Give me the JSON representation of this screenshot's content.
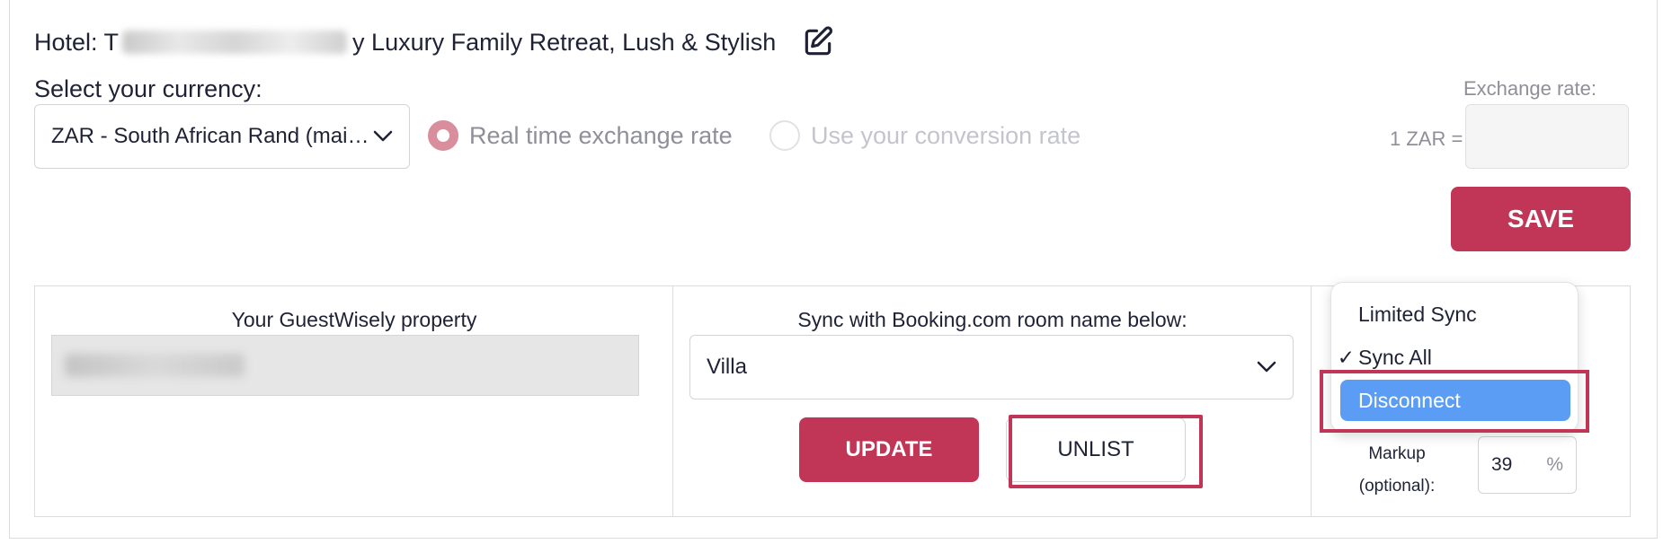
{
  "hotel": {
    "prefix": "Hotel: T",
    "name_visible": "y Luxury Family Retreat, Lush & Stylish"
  },
  "currency": {
    "label": "Select your currency:",
    "selected": "ZAR - South African Rand (mai…",
    "options": {
      "realtime_label": "Real time exchange rate",
      "custom_label": "Use your conversion rate",
      "selected": "realtime"
    }
  },
  "exchange": {
    "label": "Exchange rate:",
    "prefix": "1 ZAR =",
    "value": ""
  },
  "save_label": "SAVE",
  "table": {
    "property_label": "Your GuestWisely property",
    "sync_label": "Sync with Booking.com room name below:",
    "room_selected": "Villa",
    "update_label": "UPDATE",
    "unlist_label": "UNLIST",
    "markup_label_1": "Markup",
    "markup_label_2": "(optional):",
    "markup_value": "39",
    "markup_unit": "%"
  },
  "sync_menu": {
    "items": [
      {
        "label": "Limited Sync",
        "checked": false
      },
      {
        "label": "Sync All",
        "checked": true
      },
      {
        "label": "Disconnect",
        "checked": false,
        "highlighted": true
      }
    ],
    "check_glyph": "✓"
  },
  "colors": {
    "accent": "#c13657",
    "menu_highlight": "#5b9cf5",
    "radio_checked": "#d98e9e"
  }
}
